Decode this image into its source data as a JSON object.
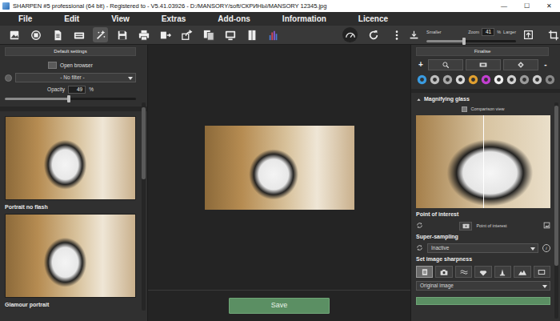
{
  "window": {
    "title": "SHARPEN #5 professional (64 bit) - Registered to - V5.41.03926 - D:/MANSORY/soft/СКРИНЫ/MANSORY 12345.jpg",
    "controls": [
      "—",
      "☐",
      "✕"
    ]
  },
  "menu": [
    "File",
    "Edit",
    "View",
    "Extras",
    "Add-ons",
    "Information",
    "Licence"
  ],
  "toolbar": {
    "tools": [
      {
        "selected": false
      },
      {
        "selected": false
      },
      {
        "selected": false
      },
      {
        "selected": false
      },
      {
        "selected": true
      },
      {
        "selected": false
      },
      {
        "selected": false
      },
      {
        "selected": false
      },
      {
        "selected": false
      },
      {
        "selected": false
      },
      {
        "selected": false
      },
      {
        "selected": false
      },
      {
        "selected": false
      }
    ],
    "view_tools": [
      {
        "selected": true
      },
      {
        "selected": false
      },
      {
        "selected": false
      }
    ],
    "zoom": {
      "smaller": "Smaller",
      "label": "Zoom",
      "value": "41",
      "unit": "%",
      "larger": "Larger",
      "level": 0.42
    }
  },
  "left_panel": {
    "header": "Default settings",
    "open_browser": "Open browser",
    "filter": "- No filter -",
    "opacity": {
      "label": "Opacity",
      "value": "49",
      "unit": "%",
      "level": 0.49
    },
    "presets": [
      {
        "label": "Portrait no flash"
      },
      {
        "label": "Glamour portrait"
      }
    ]
  },
  "center": {
    "save": "Save"
  },
  "right_panel": {
    "header": "Finalise",
    "plus": "+",
    "minus": "-",
    "magnifier": {
      "title": "Magnifying glass",
      "comparison": "Comparison view"
    },
    "point_of_interest": {
      "title": "Point of interest",
      "label": "Point of interest"
    },
    "super_sampling": {
      "title": "Super-sampling",
      "value": "Inactive",
      "info": "i"
    },
    "sharpness": {
      "title": "Set image sharpness",
      "modes": [
        {
          "selected": true
        },
        {
          "selected": false
        },
        {
          "selected": false
        },
        {
          "selected": false
        },
        {
          "selected": false
        },
        {
          "selected": false
        },
        {
          "selected": false
        }
      ],
      "source": "Original image"
    }
  }
}
